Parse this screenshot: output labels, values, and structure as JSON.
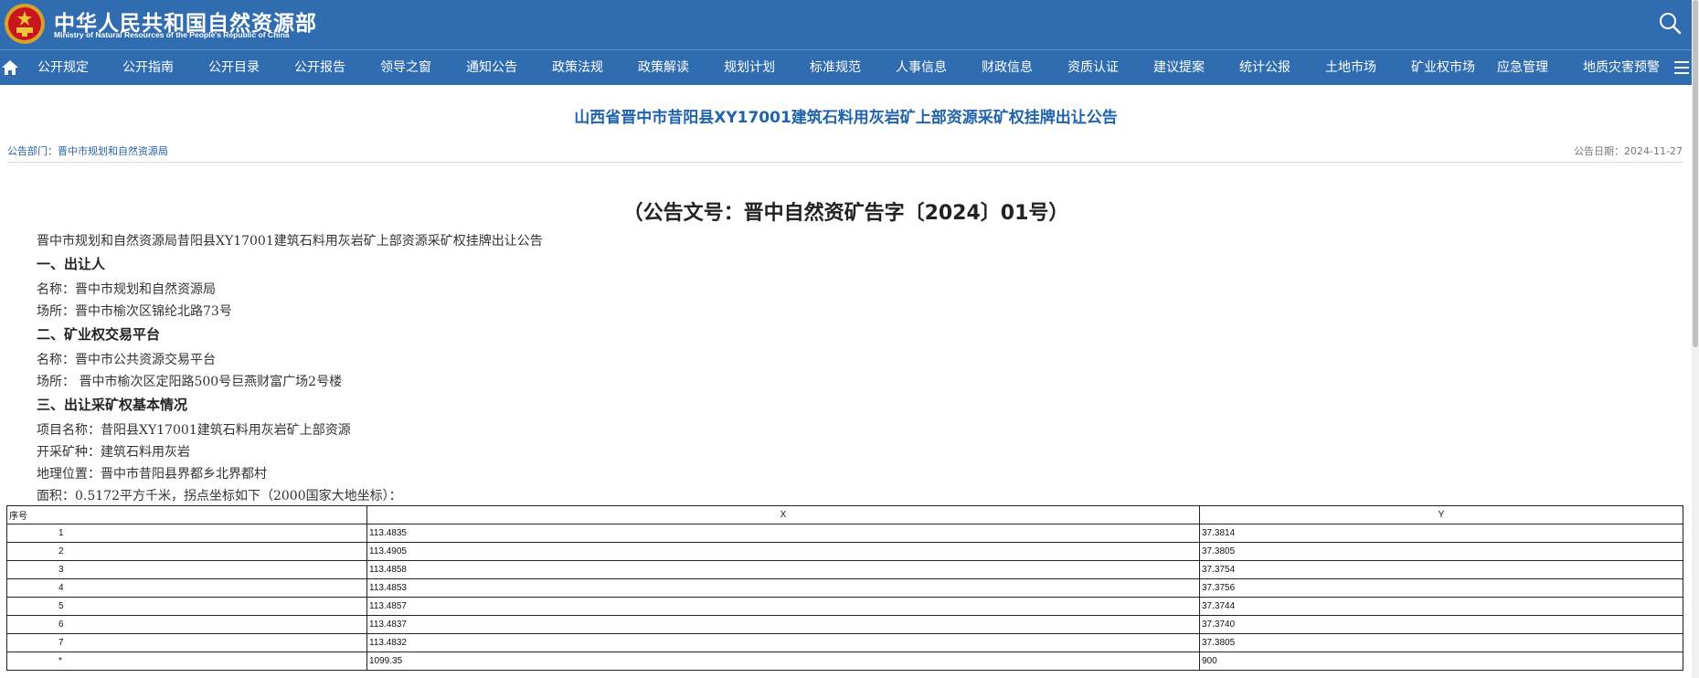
{
  "header": {
    "brand_cn": "中华人民共和国自然资源部",
    "brand_en": "Ministry of Natural Resources of the People's Republic of China",
    "emblem_icon": "national-emblem-icon",
    "search_icon": "search-icon",
    "bg_color": "#2f6cb0"
  },
  "nav": {
    "home_icon": "home-icon",
    "menu_icon": "hamburger-menu-icon",
    "items": [
      "公开规定",
      "公开指南",
      "公开目录",
      "公开报告",
      "领导之窗",
      "通知公告",
      "政策法规",
      "政策解读",
      "规划计划",
      "标准规范",
      "人事信息",
      "财政信息",
      "资质认证",
      "建议提案",
      "统计公报",
      "土地市场",
      "矿业权市场",
      "应急管理",
      "地质灾害预警"
    ]
  },
  "article": {
    "title": "山西省晋中市昔阳县XY17001建筑石料用灰岩矿上部资源采矿权挂牌出让公告",
    "dept": "公告部门：晋中市规划和自然资源局",
    "date": "公告日期：2024-11-27",
    "doc_no": "（公告文号：晋中自然资矿告字〔2024〕01号）",
    "intro": "晋中市规划和自然资源局昔阳县XY17001建筑石料用灰岩矿上部资源采矿权挂牌出让公告",
    "s1_head": "一、出让人",
    "s1_name": "名称：晋中市规划和自然资源局",
    "s1_place": "场所：晋中市榆次区锦纶北路73号",
    "s2_head": "二、矿业权交易平台",
    "s2_name": "名称：晋中市公共资源交易平台",
    "s2_place": "场所：  晋中市榆次区定阳路500号巨燕财富广场2号楼",
    "s3_head": "三、出让采矿权基本情况",
    "s3_project": "项目名称：昔阳县XY17001建筑石料用灰岩矿上部资源",
    "s3_mineral": "开采矿种：建筑石料用灰岩",
    "s3_location": "地理位置：晋中市昔阳县界都乡北界都村",
    "s3_area": "面积：0.5172平方千米，拐点坐标如下（2000国家大地坐标）："
  },
  "table": {
    "headers": [
      "序号",
      "X",
      "Y"
    ],
    "rows": [
      [
        "1",
        "113.4835",
        "37.3814"
      ],
      [
        "2",
        "113.4905",
        "37.3805"
      ],
      [
        "3",
        "113.4858",
        "37.3754"
      ],
      [
        "4",
        "113.4853",
        "37.3756"
      ],
      [
        "5",
        "113.4857",
        "37.3744"
      ],
      [
        "6",
        "113.4837",
        "37.3740"
      ],
      [
        "7",
        "113.4832",
        "37.3805"
      ],
      [
        "*",
        "1099.35",
        "900"
      ]
    ]
  }
}
